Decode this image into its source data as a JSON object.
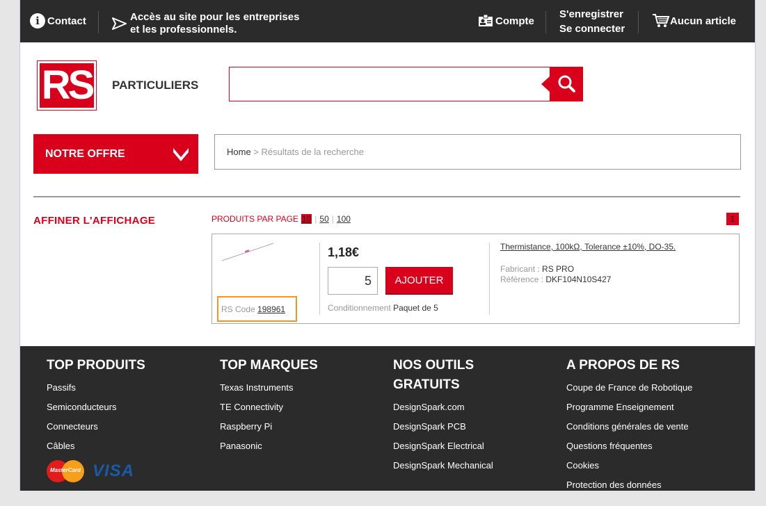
{
  "topbar": {
    "contact": "Contact",
    "pro_line1": "Accès au site pour les entreprises",
    "pro_line2": "et les professionnels.",
    "compte": "Compte",
    "register": "S'enregistrer",
    "login": "Se connecter",
    "cart": "Aucun article"
  },
  "header": {
    "logo_text": "RS",
    "segment": "PARTICULIERS",
    "search_value": ""
  },
  "nav": {
    "offer": "NOTRE OFFRE",
    "breadcrumb_home": "Home",
    "breadcrumb_sep": " > ",
    "breadcrumb_current": "Résultats de la recherche"
  },
  "filters": {
    "title": "AFFINER L'AFFICHAGE",
    "per_page_label": "PRODUITS PAR PAGE",
    "per_page_options": [
      "10",
      "50",
      "100"
    ],
    "current_page": "1"
  },
  "product": {
    "rs_code_label": "RS Code",
    "rs_code": "198961",
    "price": "1,18€",
    "quantity": "5",
    "add_button": "AJOUTER",
    "packaging_label": "Conditionnement",
    "packaging_value": "Paquet de 5",
    "title": "Thermistance, 100kΩ, Tolerance ±10%, DO-35.",
    "manufacturer_label": "Fabricant :",
    "manufacturer": "RS PRO",
    "reference_label": "Référence :",
    "reference": "DKF104N10S427"
  },
  "footer": {
    "col1_title": "TOP PRODUITS",
    "col1_links": [
      "Passifs",
      "Semiconducteurs",
      "Connecteurs",
      "Câbles"
    ],
    "col2_title": "TOP MARQUES",
    "col2_links": [
      "Texas Instruments",
      "TE Connectivity",
      "Raspberry Pi",
      "Panasonic"
    ],
    "col3_title_line1": "NOS OUTILS",
    "col3_title_line2": "GRATUITS",
    "col3_links": [
      "DesignSpark.com",
      "DesignSpark PCB",
      "DesignSpark Electrical",
      "DesignSpark Mechanical"
    ],
    "col4_title": "A PROPOS DE RS",
    "col4_links": [
      "Coupe de France de Robotique",
      "Programme Enseignement",
      "Conditions générales de vente",
      "Questions fréquentes",
      "Cookies",
      "Protection des données"
    ],
    "mastercard": "MasterCard",
    "visa": "VISA"
  },
  "colors": {
    "brand_red": "#d9001b",
    "dark_bar": "#2b2b2b",
    "highlight": "#f7941d"
  }
}
